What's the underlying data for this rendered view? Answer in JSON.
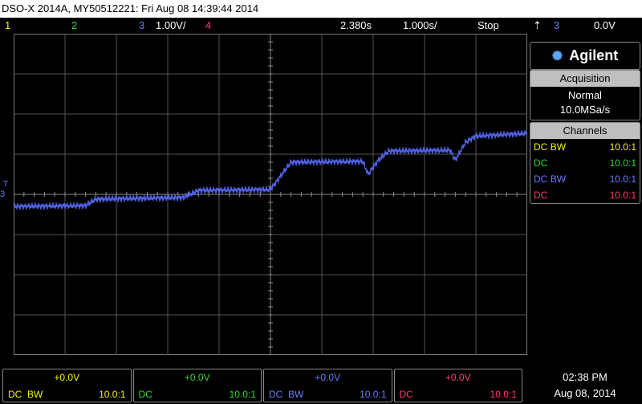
{
  "title": "DSO-X 2014A, MY50512221: Fri Aug 08 14:39:44 2014",
  "status": {
    "ch1_num": "1",
    "ch2_num": "2",
    "ch3_num": "3",
    "ch3_scale": "1.00V/",
    "ch4_num": "4",
    "time_delay": "2.380s",
    "timebase": "1.000s/",
    "run_state": "Stop",
    "trigger_icon": "trigger-edge-icon",
    "trigger_source": "3",
    "trigger_level": "0.0V"
  },
  "brand": {
    "name": "Agilent",
    "icon": "agilent-spark-icon"
  },
  "acquisition": {
    "header": "Acquisition",
    "mode": "Normal",
    "rate": "10.0MSa/s"
  },
  "channels_panel": {
    "header": "Channels",
    "rows": [
      {
        "coupling": "DC",
        "bw": "BW",
        "probe": "10.0:1",
        "color": "#f5f500"
      },
      {
        "coupling": "DC",
        "bw": "",
        "probe": "10.0:1",
        "color": "#33d633"
      },
      {
        "coupling": "DC",
        "bw": "BW",
        "probe": "10.0:1",
        "color": "#6b7cff"
      },
      {
        "coupling": "DC",
        "bw": "",
        "probe": "10.0:1",
        "color": "#ff3a6e"
      }
    ]
  },
  "bottom_channels": [
    {
      "offset": "+0.0V",
      "coupling": "DC",
      "bw": "BW",
      "probe": "10.0:1",
      "color": "#f5f500"
    },
    {
      "offset": "+0.0V",
      "coupling": "DC",
      "bw": "",
      "probe": "10.0:1",
      "color": "#33d633"
    },
    {
      "offset": "+0.0V",
      "coupling": "DC",
      "bw": "BW",
      "probe": "10.0:1",
      "color": "#6b7cff"
    },
    {
      "offset": "+0.0V",
      "coupling": "DC",
      "bw": "",
      "probe": "10.0:1",
      "color": "#ff3a6e"
    }
  ],
  "clock": {
    "time": "02:38 PM",
    "date": "Aug 08, 2014"
  },
  "markers": {
    "ground_label": "3",
    "trigger_label": "T"
  },
  "trace": {
    "color": "#5a6cff",
    "levels": [
      {
        "t": 0.0,
        "v": -0.3
      },
      {
        "t": 0.14,
        "v": -0.28
      },
      {
        "t": 0.16,
        "v": -0.12
      },
      {
        "t": 0.33,
        "v": -0.08
      },
      {
        "t": 0.36,
        "v": 0.1
      },
      {
        "t": 0.5,
        "v": 0.12
      },
      {
        "t": 0.54,
        "v": 0.8
      },
      {
        "t": 0.68,
        "v": 0.82
      },
      {
        "t": 0.69,
        "v": 0.5
      },
      {
        "t": 0.71,
        "v": 0.85
      },
      {
        "t": 0.73,
        "v": 1.08
      },
      {
        "t": 0.85,
        "v": 1.1
      },
      {
        "t": 0.86,
        "v": 0.85
      },
      {
        "t": 0.88,
        "v": 1.3
      },
      {
        "t": 0.9,
        "v": 1.45
      },
      {
        "t": 1.0,
        "v": 1.52
      }
    ]
  }
}
